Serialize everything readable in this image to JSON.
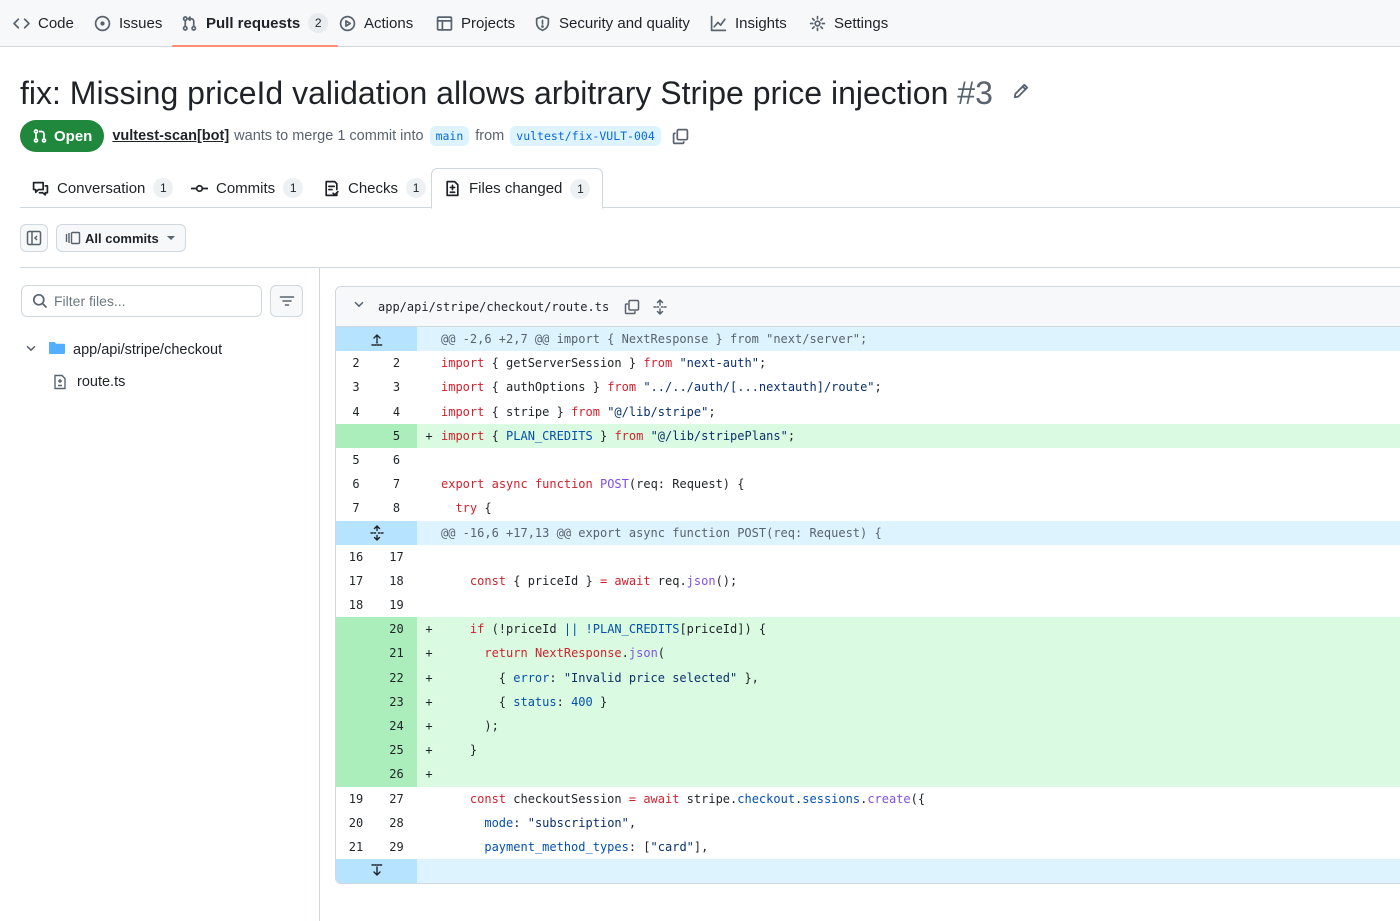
{
  "repo_nav": {
    "items": [
      {
        "label": "Code",
        "icon": "code-icon"
      },
      {
        "label": "Issues",
        "icon": "issue-icon"
      },
      {
        "label": "Pull requests",
        "icon": "pull-request-icon",
        "count": "2",
        "selected": true
      },
      {
        "label": "Actions",
        "icon": "play-icon"
      },
      {
        "label": "Projects",
        "icon": "table-icon"
      },
      {
        "label": "Security and quality",
        "icon": "shield-icon"
      },
      {
        "label": "Insights",
        "icon": "graph-icon"
      },
      {
        "label": "Settings",
        "icon": "gear-icon"
      }
    ]
  },
  "pr": {
    "title": "fix: Missing priceId validation allows arbitrary Stripe price injection",
    "number": "#3",
    "state": "Open",
    "author": "vultest-scan[bot]",
    "merge_text": "wants to merge 1 commit into",
    "base_branch": "main",
    "from_text": "from",
    "head_branch": "vultest/fix-VULT-004"
  },
  "tabs": [
    {
      "label": "Conversation",
      "count": "1",
      "icon": "comment-icon"
    },
    {
      "label": "Commits",
      "count": "1",
      "icon": "commit-icon"
    },
    {
      "label": "Checks",
      "count": "1",
      "icon": "checklist-icon"
    },
    {
      "label": "Files changed",
      "count": "1",
      "icon": "file-diff-icon",
      "active": true
    }
  ],
  "toolbar": {
    "commits_label": "All commits"
  },
  "file_tree": {
    "filter_placeholder": "Filter files...",
    "directory": "app/api/stripe/checkout",
    "file": "route.ts"
  },
  "diff": {
    "file_path": "app/api/stripe/checkout/route.ts",
    "hunk_top": "@@ -2,6 +2,7 @@ import { NextResponse } from \"next/server\";",
    "hunk_mid": "@@ -16,6 +17,13 @@ export async function POST(req: Request) {",
    "lines_a": [
      {
        "old": "2",
        "new": "2",
        "marker": "",
        "type": "ctx"
      },
      {
        "old": "3",
        "new": "3",
        "marker": "",
        "type": "ctx"
      },
      {
        "old": "4",
        "new": "4",
        "marker": "",
        "type": "ctx"
      },
      {
        "old": "",
        "new": "5",
        "marker": "+",
        "type": "add"
      },
      {
        "old": "5",
        "new": "6",
        "marker": "",
        "type": "ctx"
      },
      {
        "old": "6",
        "new": "7",
        "marker": "",
        "type": "ctx"
      },
      {
        "old": "7",
        "new": "8",
        "marker": "",
        "type": "ctx"
      }
    ],
    "lines_b": [
      {
        "old": "16",
        "new": "17",
        "marker": "",
        "type": "ctx"
      },
      {
        "old": "17",
        "new": "18",
        "marker": "",
        "type": "ctx"
      },
      {
        "old": "18",
        "new": "19",
        "marker": "",
        "type": "ctx"
      },
      {
        "old": "",
        "new": "20",
        "marker": "+",
        "type": "add"
      },
      {
        "old": "",
        "new": "21",
        "marker": "+",
        "type": "add"
      },
      {
        "old": "",
        "new": "22",
        "marker": "+",
        "type": "add"
      },
      {
        "old": "",
        "new": "23",
        "marker": "+",
        "type": "add"
      },
      {
        "old": "",
        "new": "24",
        "marker": "+",
        "type": "add"
      },
      {
        "old": "",
        "new": "25",
        "marker": "+",
        "type": "add"
      },
      {
        "old": "",
        "new": "26",
        "marker": "+",
        "type": "add"
      },
      {
        "old": "19",
        "new": "27",
        "marker": "",
        "type": "ctx"
      },
      {
        "old": "20",
        "new": "28",
        "marker": "",
        "type": "ctx"
      },
      {
        "old": "21",
        "new": "29",
        "marker": "",
        "type": "ctx"
      }
    ],
    "code": {
      "a0": [
        "import",
        " { getServerSession } ",
        "from",
        " ",
        "\"next-auth\"",
        ";"
      ],
      "a1": [
        "import",
        " { authOptions } ",
        "from",
        " ",
        "\"../../auth/[...nextauth]/route\"",
        ";"
      ],
      "a2": [
        "import",
        " { stripe } ",
        "from",
        " ",
        "\"@/lib/stripe\"",
        ";"
      ],
      "a3": [
        "import",
        " { ",
        "PLAN_CREDITS",
        " } ",
        "from",
        " ",
        "\"@/lib/stripePlans\"",
        ";"
      ],
      "a5": [
        "export",
        " ",
        "async",
        " ",
        "function",
        " ",
        "POST",
        "(req: Request) {"
      ],
      "a6": [
        "  ",
        "try",
        " {"
      ],
      "b1": [
        "    ",
        "const",
        " { priceId } ",
        "=",
        " ",
        "await",
        " req.",
        "json",
        "();"
      ],
      "b3": [
        "    ",
        "if",
        " (!priceId ",
        "||",
        " ",
        "!PLAN_CREDITS",
        "[priceId]) {"
      ],
      "b4": [
        "      ",
        "return",
        " ",
        "NextResponse",
        ".",
        "json",
        "("
      ],
      "b5": [
        "        { ",
        "error",
        ": ",
        "\"Invalid price selected\"",
        " },"
      ],
      "b6": [
        "        { ",
        "status",
        ": ",
        "400",
        " }"
      ],
      "b7": [
        "      );"
      ],
      "b8": [
        "    }"
      ],
      "b10": [
        "    ",
        "const",
        " checkoutSession ",
        "=",
        " ",
        "await",
        " stripe.",
        "checkout",
        ".",
        "sessions",
        ".",
        "create",
        "({"
      ],
      "b11": [
        "      ",
        "mode",
        ": ",
        "\"subscription\"",
        ","
      ],
      "b12": [
        "      ",
        "payment_method_types",
        ": [",
        "\"card\"",
        "],"
      ]
    }
  }
}
